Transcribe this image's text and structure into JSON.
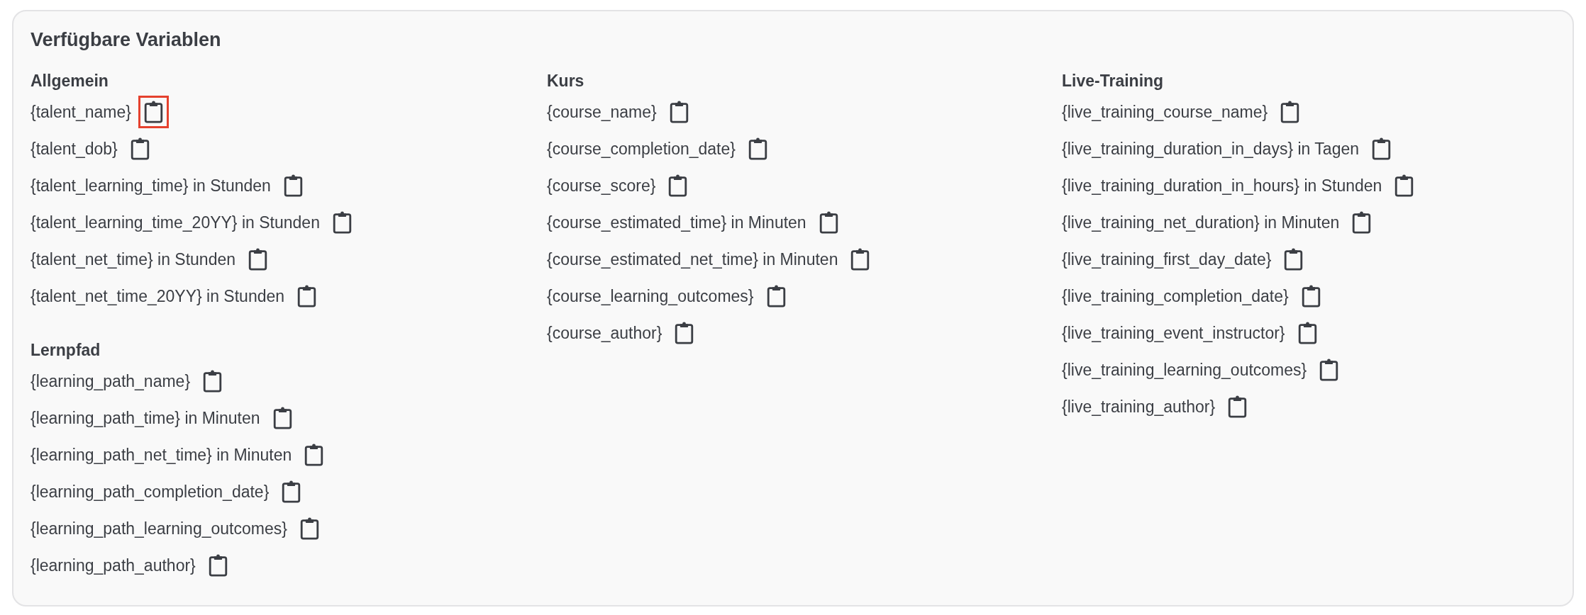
{
  "title": "Verfügbare Variablen",
  "columns": [
    {
      "sections": [
        {
          "heading": "Allgemein",
          "variables": [
            {
              "text": "{talent_name}",
              "highlighted": true
            },
            {
              "text": "{talent_dob}",
              "highlighted": false
            },
            {
              "text": "{talent_learning_time} in Stunden",
              "highlighted": false
            },
            {
              "text": "{talent_learning_time_20YY} in Stunden",
              "highlighted": false
            },
            {
              "text": "{talent_net_time} in Stunden",
              "highlighted": false
            },
            {
              "text": "{talent_net_time_20YY} in Stunden",
              "highlighted": false
            }
          ]
        },
        {
          "heading": "Lernpfad",
          "variables": [
            {
              "text": "{learning_path_name}",
              "highlighted": false
            },
            {
              "text": "{learning_path_time} in Minuten",
              "highlighted": false
            },
            {
              "text": "{learning_path_net_time} in Minuten",
              "highlighted": false
            },
            {
              "text": "{learning_path_completion_date}",
              "highlighted": false
            },
            {
              "text": "{learning_path_learning_outcomes}",
              "highlighted": false
            },
            {
              "text": "{learning_path_author}",
              "highlighted": false
            }
          ]
        }
      ]
    },
    {
      "sections": [
        {
          "heading": "Kurs",
          "variables": [
            {
              "text": "{course_name}",
              "highlighted": false
            },
            {
              "text": "{course_completion_date}",
              "highlighted": false
            },
            {
              "text": "{course_score}",
              "highlighted": false
            },
            {
              "text": "{course_estimated_time} in Minuten",
              "highlighted": false
            },
            {
              "text": "{course_estimated_net_time} in Minuten",
              "highlighted": false
            },
            {
              "text": "{course_learning_outcomes}",
              "highlighted": false
            },
            {
              "text": "{course_author}",
              "highlighted": false
            }
          ]
        }
      ]
    },
    {
      "sections": [
        {
          "heading": "Live-Training",
          "variables": [
            {
              "text": "{live_training_course_name}",
              "highlighted": false
            },
            {
              "text": "{live_training_duration_in_days} in Tagen",
              "highlighted": false
            },
            {
              "text": "{live_training_duration_in_hours} in Stunden",
              "highlighted": false
            },
            {
              "text": "{live_training_net_duration} in Minuten",
              "highlighted": false
            },
            {
              "text": "{live_training_first_day_date}",
              "highlighted": false
            },
            {
              "text": "{live_training_completion_date}",
              "highlighted": false
            },
            {
              "text": "{live_training_event_instructor}",
              "highlighted": false
            },
            {
              "text": "{live_training_learning_outcomes}",
              "highlighted": false
            },
            {
              "text": "{live_training_author}",
              "highlighted": false
            }
          ]
        }
      ]
    }
  ]
}
